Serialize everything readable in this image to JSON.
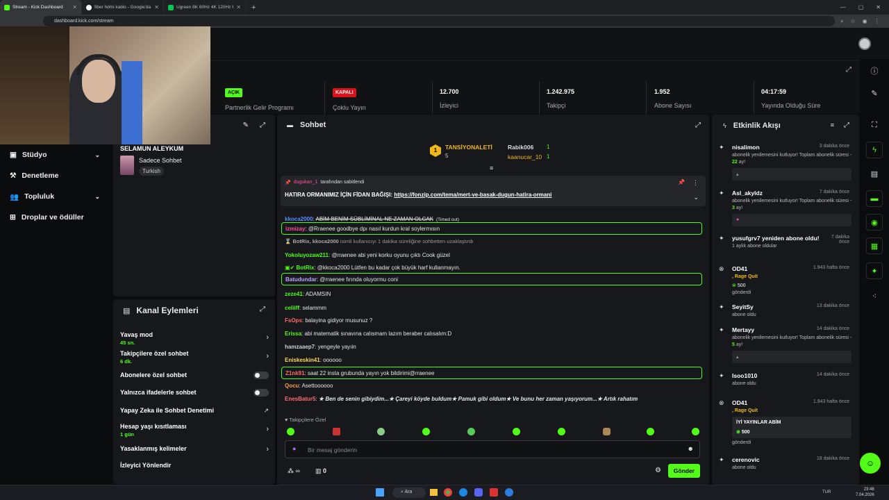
{
  "browser": {
    "tabs": [
      {
        "title": "Stream - Kick Dashboard",
        "color": "#53fc18",
        "active": true
      },
      {
        "title": "fiber hdmi kablo - Google'da Ara",
        "color": "#ffffff",
        "active": false
      },
      {
        "title": "Ugreen 8K 60Hz 4K 120Hz HDMI",
        "color": "#00c853",
        "active": false
      }
    ],
    "url": "dashboard.kick.com/stream"
  },
  "stats": [
    {
      "badge": "AÇIK",
      "badge_color": "#53fc18",
      "label": "Partnerlik Gelir Programı"
    },
    {
      "badge": "KAPALI",
      "badge_color": "#e0111b",
      "label": "Çoklu Yayın"
    },
    {
      "value": "12.700",
      "label": "İzleyici"
    },
    {
      "value": "1.242.975",
      "label": "Takipçi"
    },
    {
      "value": "1.952",
      "label": "Abone Sayısı"
    },
    {
      "value": "04:17:59",
      "label": "Yayında Olduğu Süre"
    }
  ],
  "nav": [
    {
      "label": "Stüdyo",
      "icon": "studio-icon",
      "chevron": true
    },
    {
      "label": "Denetleme",
      "icon": "gavel-icon",
      "chevron": false
    },
    {
      "label": "Topluluk",
      "icon": "users-icon",
      "chevron": true
    },
    {
      "label": "Droplar ve ödüller",
      "icon": "gift-icon",
      "chevron": false
    }
  ],
  "stream_info": {
    "title": "SELAMUN ALEYKUM",
    "category": "Sadece Sohbet",
    "language": "Turkish"
  },
  "actions": {
    "title": "Kanal Eylemleri",
    "items": [
      {
        "name": "Yavaş mod",
        "sub": "45 sn.",
        "control": "chevron"
      },
      {
        "name": "Takipçilere özel sohbet",
        "sub": "6 dk.",
        "control": "chevron"
      },
      {
        "name": "Abonelere özel sohbet",
        "sub": "",
        "control": "toggle"
      },
      {
        "name": "Yalnızca ifadelerle sohbet",
        "sub": "",
        "control": "toggle"
      },
      {
        "name": "Yapay Zeka ile Sohbet Denetimi",
        "sub": "",
        "control": "external"
      },
      {
        "name": "Hesap yaşı kısıtlaması",
        "sub": "1 gün",
        "control": "chevron"
      },
      {
        "name": "Yasaklanmış kelimeler",
        "sub": "",
        "control": "chevron"
      },
      {
        "name": "İzleyici Yönlendir",
        "sub": "",
        "control": "none"
      }
    ]
  },
  "chat": {
    "title": "Sohbet",
    "leaderboard": {
      "top_name": "TANSİYONALETİ",
      "top_points": "5",
      "rank": "1",
      "second": {
        "name": "Rabik006",
        "points": "1"
      },
      "third": {
        "name": "kaanucar_10",
        "points": "1"
      }
    },
    "pinned": {
      "pinned_by": "dugukan_1",
      "pinned_suffix": "tarafından sabitlendi",
      "text_prefix": "HATIRA ORMANIMIZ İÇİN FİDAN BAĞIŞI:",
      "link": "https://fonzip.com/tema/mert-ve-basak-dugun-hatira-ormani"
    },
    "messages": [
      {
        "user": "kkoca2000",
        "color": "#5a8cff",
        "text": "ABİM BENİM SÜBLİMİNAL NE ZAMAN OLCAK",
        "note": "(Timed out)",
        "highlight": false,
        "strike": true
      },
      {
        "user": "izmizay",
        "color": "#ff4fa0",
        "text": "@Rraenee goodbye dpı nasıl kurdun kral soylermısın",
        "highlight": true
      },
      {
        "user": "BotRix, kkoca2000",
        "color": "#aaaaaa",
        "text": "isimli kullanıcıyı 1 dakika süreliğine sohbetten uzaklaştırdı",
        "highlight": false,
        "system": true
      },
      {
        "user": "Yokoluyozaw211",
        "color": "#53fc18",
        "text": "@rraenee abi yeni korku oyunu çıktı Cook güzel",
        "highlight": false
      },
      {
        "user": "BotRix",
        "color": "#53fc18",
        "text": "@kkoca2000 Lütfen bu kadar çok büyük harf kullanmayın.",
        "highlight": false,
        "badges": true
      },
      {
        "user": "Batudundar",
        "color": "#b9a6ff",
        "text": "@rraenee fırında oluyormu coni",
        "highlight": true
      },
      {
        "user": "zeze41",
        "color": "#53fc18",
        "text": "ADAMSIN",
        "highlight": false
      },
      {
        "user": "celiiff",
        "color": "#53fc18",
        "text": "selammm",
        "highlight": false
      },
      {
        "user": "FsOps",
        "color": "#ff6a6a",
        "text": "balayina gidiyor musunuz ?",
        "highlight": false
      },
      {
        "user": "Erissa",
        "color": "#53fc18",
        "text": "abi matematik sınavına calısmam lazım beraber calısalım:D",
        "highlight": false
      },
      {
        "user": "hamzaaep7",
        "color": "#d0d0d0",
        "text": "yengeyle yayıin",
        "highlight": false
      },
      {
        "user": "Eniskeskin41",
        "color": "#ffd84d",
        "text": "oooooo",
        "highlight": false
      },
      {
        "user": "Z1nk91",
        "color": "#ff6a6a",
        "text": "saat 22 insta grubunda yayın yok bildirimi@rraenee",
        "highlight": true
      },
      {
        "user": "Qocu",
        "color": "#ff9a3c",
        "text": "Asettoooooo",
        "highlight": false
      },
      {
        "user": "EnesBatur5",
        "color": "#ff6a6a",
        "text": "★ Ben de senin gibiydim...★ Çareyi köyde buldum★ Pamuk gibi oldum★ Ve bunu her zaman yaşıyorum...★ Artık rahatım",
        "highlight": false,
        "italic": true
      }
    ],
    "follower_label": "Takipçilere Özel",
    "input_placeholder": "Bir mesaj gönderin",
    "send_label": "Gönder",
    "infinity": "∞",
    "gift_count": "0"
  },
  "activity": {
    "title": "Etkinlik Akışı",
    "events": [
      {
        "name": "nisalimon",
        "time": "3 dakika önce",
        "desc": "abonelik yenilemesini kutluyor! Toplam abonelik süresi - ",
        "months": "22",
        "unit": " ay!",
        "box": "▴"
      },
      {
        "name": "Asl_akyldz",
        "time": "7 dakika önce",
        "desc": "abonelik yenilemesini kutluyor! Toplam abonelik süresi - ",
        "months": "3",
        "unit": " ay!",
        "box": "●"
      },
      {
        "name": "yusufgrv7 yeniden abone oldu!",
        "time": "7 dakika önce",
        "desc": "1 aylık abone oldular"
      },
      {
        "name": "OD41",
        "time": "1.943 hafta önce",
        "desc": ", Rage Quit",
        "amount": "500",
        "sent": "gönderdi"
      },
      {
        "name": "SeyitSy",
        "time": "13 dakika önce",
        "desc": "abone oldu"
      },
      {
        "name": "Mertayy",
        "time": "14 dakika önce",
        "desc": "abonelik yenilemesini kutluyor! Toplam abonelik süresi - ",
        "months": "5",
        "unit": " ay!",
        "box": "▴"
      },
      {
        "name": "Isoo1010",
        "time": "14 dakika önce",
        "desc": "abone oldu"
      },
      {
        "name": "OD41",
        "time": "1.943 hafta önce",
        "desc": ", Rage Quit",
        "quote": "İYİ YAYINLAR ABİM",
        "amount": "500",
        "sent": "gönderdi"
      },
      {
        "name": "cerenovic",
        "time": "18 dakika önce",
        "desc": "abone oldu"
      }
    ]
  },
  "taskbar": {
    "search": "Ara",
    "lang": "TUR",
    "time": "23:48",
    "date": "7.04.2026"
  }
}
